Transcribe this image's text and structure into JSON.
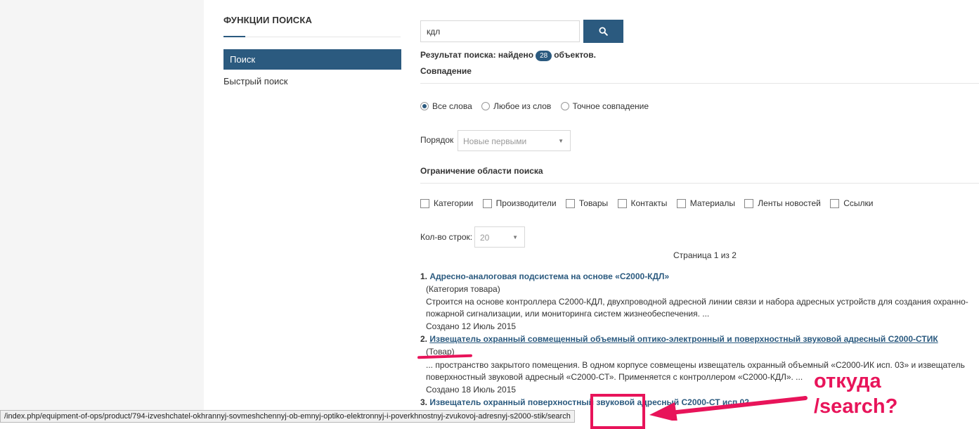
{
  "sidebar": {
    "title": "ФУНКЦИИ ПОИСКА",
    "items": [
      {
        "label": "Поиск"
      },
      {
        "label": "Быстрый поиск"
      }
    ]
  },
  "search": {
    "query": "кдл",
    "button_icon": "search-icon",
    "result_prefix": "Результат поиска: найдено",
    "count": "28",
    "result_suffix": "объектов."
  },
  "match": {
    "label": "Совпадение",
    "options": [
      "Все слова",
      "Любое из слов",
      "Точное совпадение"
    ],
    "selected": "Все слова"
  },
  "order": {
    "label": "Порядок",
    "value": "Новые первыми"
  },
  "scope": {
    "label": "Ограничение области поиска",
    "options": [
      "Категории",
      "Производители",
      "Товары",
      "Контакты",
      "Материалы",
      "Ленты новостей",
      "Ссылки"
    ]
  },
  "rows": {
    "label": "Кол-во строк:",
    "value": "20"
  },
  "pager": {
    "text": "Страница 1 из 2"
  },
  "results": [
    {
      "num": "1.",
      "title": "Адресно-аналоговая подсистема на основе «С2000-КДЛ»",
      "type": "(Категория товара)",
      "snippet_1": "Строится на основе контроллера С2000-КДЛ, двухпроводной адресной линии связи и набора адресных устройств для создания охранно-",
      "snippet_2": "пожарной сигнализации, или мониторинга систем жизнеобеспечения.  ...",
      "created": "Создано 12 Июль 2015"
    },
    {
      "num": "2.",
      "title": "Извещатель охранный совмещенный объемный оптико-электронный и поверхностный звуковой адресный С2000-СТИК",
      "type": "(Товар)",
      "snippet_1": "... пространство закрытого помещения. В одном корпусе совмещены извещатель охранный объемный «С2000-ИК исп. 03» и извещатель",
      "snippet_2": "поверхностный звуковой адресный «С2000-СТ». Применяется с контроллером «С2000-КДЛ». ...",
      "created": "Создано 18 Июль 2015"
    },
    {
      "num": "3.",
      "title": "Извещатель охранный поверхностный звуковой адресный С2000-СТ исп.02"
    }
  ],
  "status_bar": {
    "url": "/index.php/equipment-of-ops/product/794-izveshchatel-okhrannyj-sovmeshchennyj-ob-emnyj-optiko-elektronnyj-i-poverkhnostnyj-zvukovoj-adresnyj-s2000-stik/search"
  },
  "annotation": {
    "line1": "откуда",
    "line2": "/search?",
    "color": "#e8145a"
  },
  "colors": {
    "accent": "#2b5a7f"
  }
}
